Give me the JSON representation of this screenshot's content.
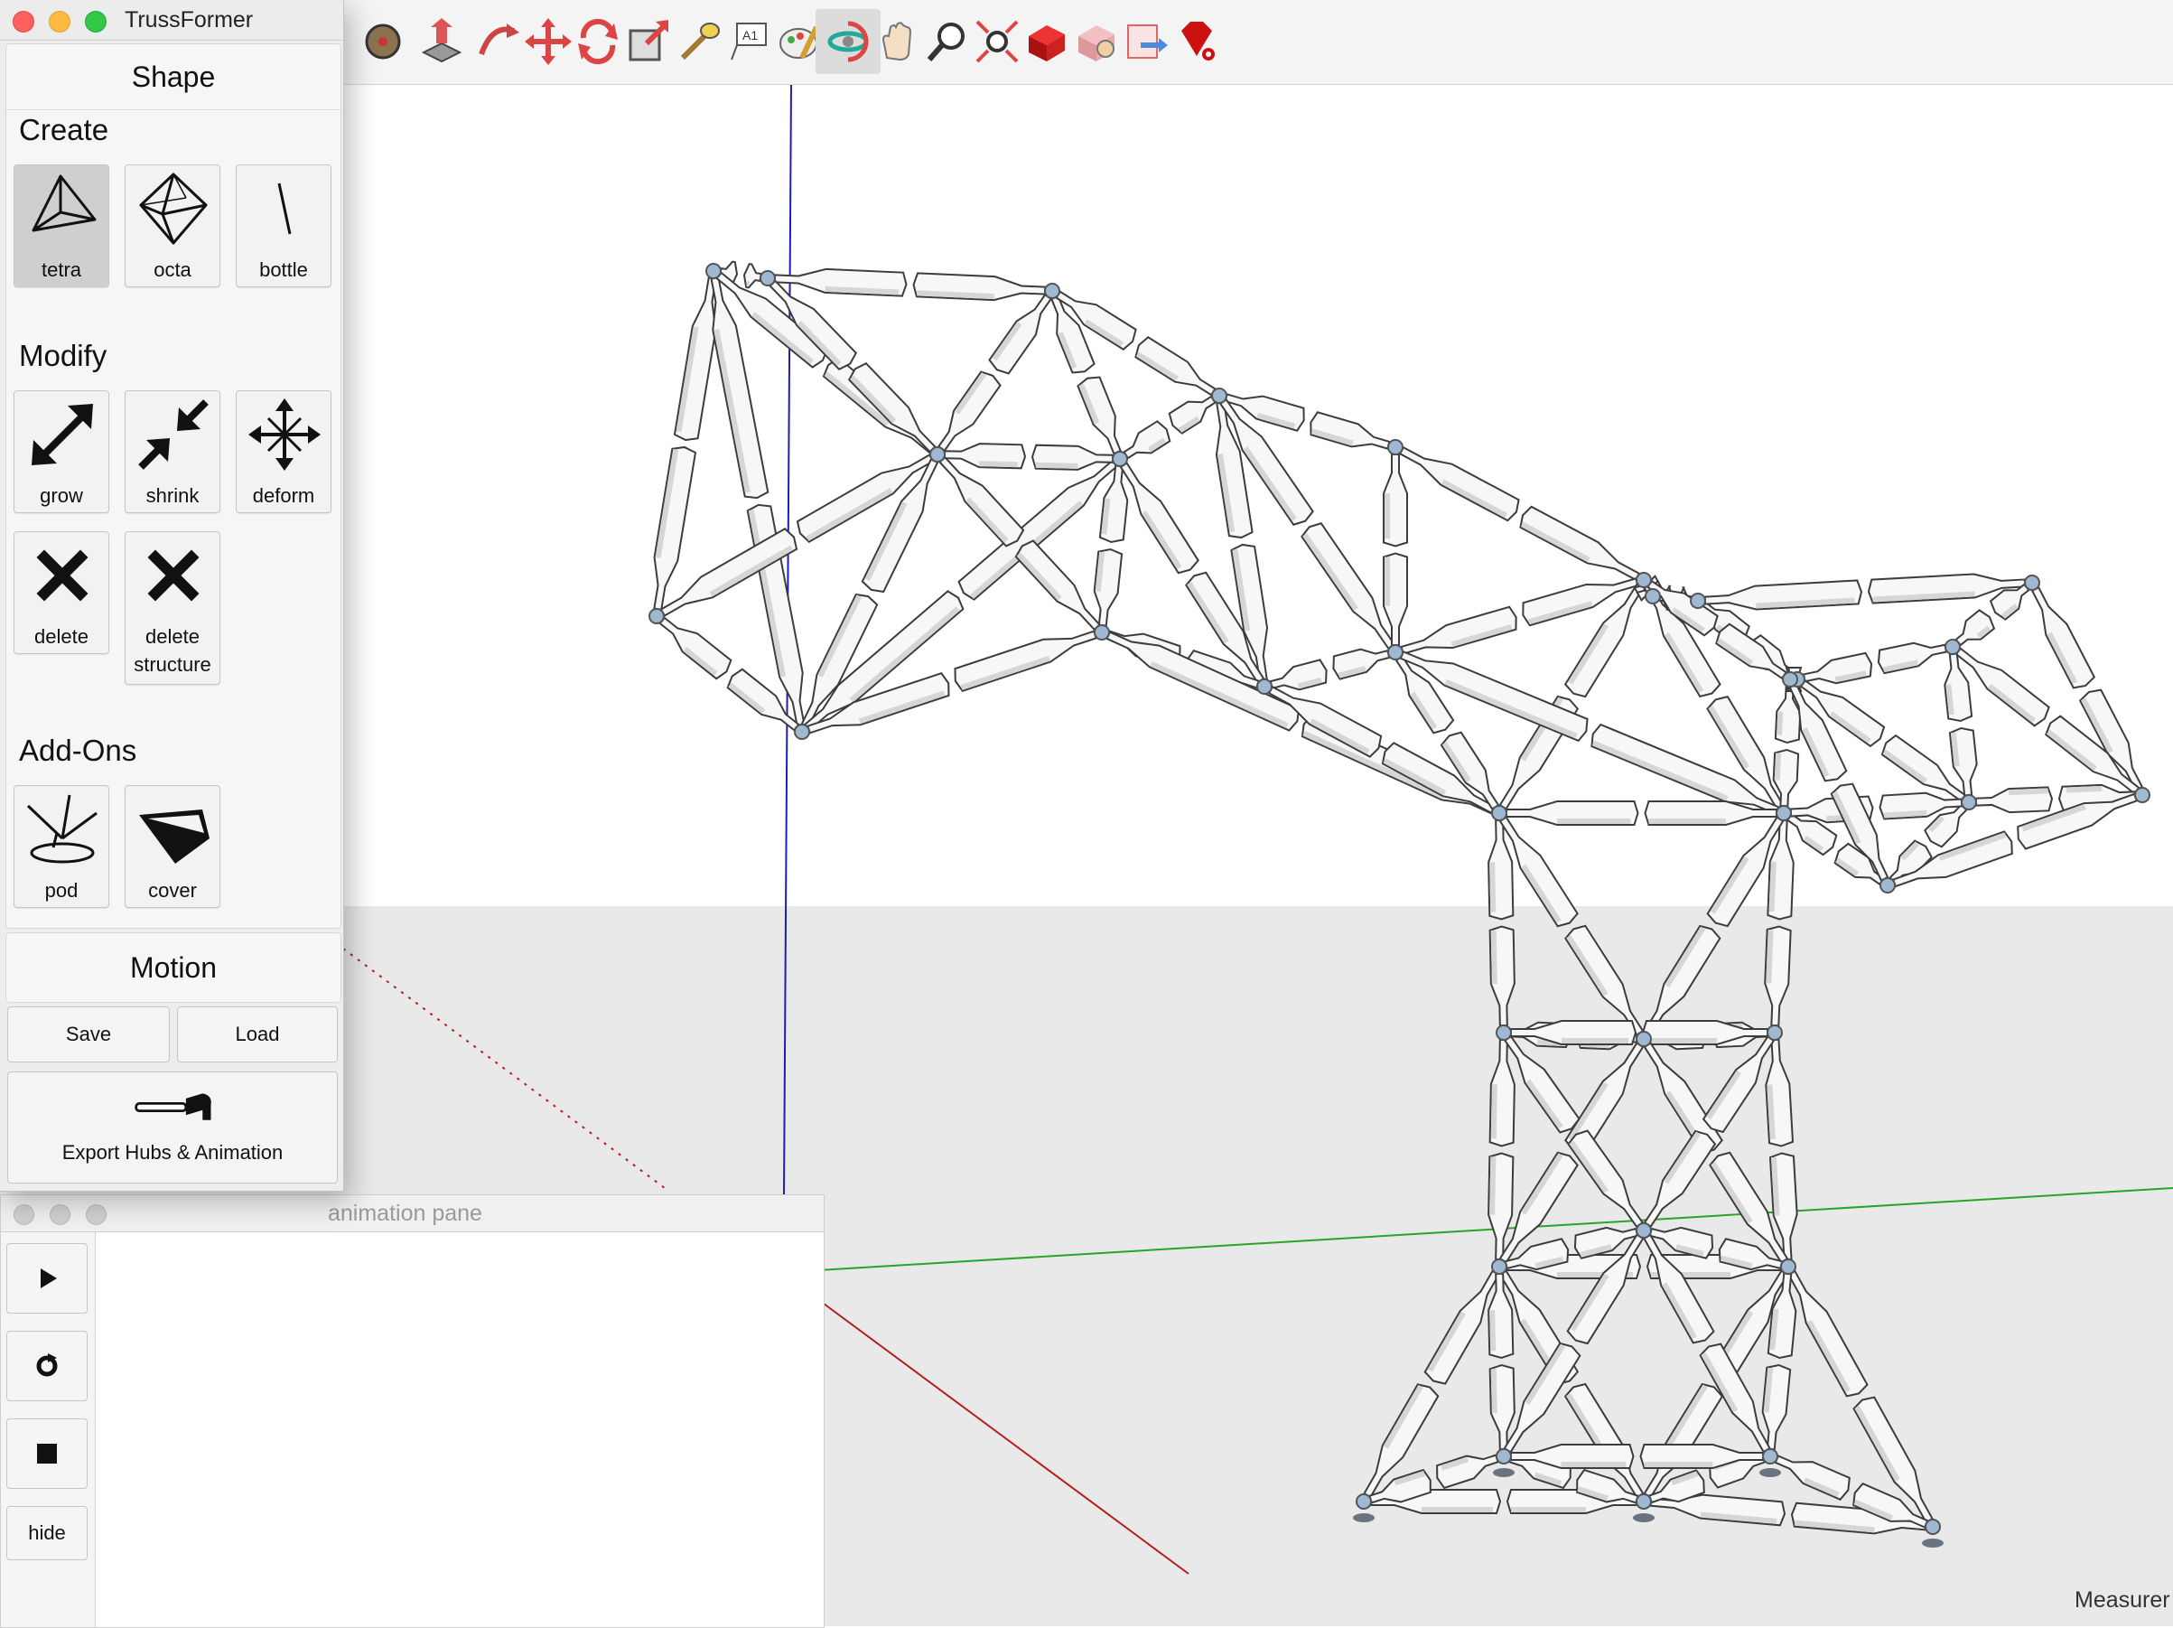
{
  "app": {
    "window_title": "TrussFormer"
  },
  "shape_panel": {
    "header": "Shape",
    "create": {
      "title": "Create",
      "tools": [
        {
          "label": "tetra",
          "icon": "tetrahedron-icon",
          "pressed": true
        },
        {
          "label": "octa",
          "icon": "octahedron-icon"
        },
        {
          "label": "bottle",
          "icon": "bottle-icon"
        }
      ]
    },
    "modify": {
      "title": "Modify",
      "tools": [
        {
          "label": "grow",
          "icon": "grow-arrows-icon"
        },
        {
          "label": "shrink",
          "icon": "shrink-arrows-icon"
        },
        {
          "label": "deform",
          "icon": "deform-arrows-icon"
        },
        {
          "label": "delete",
          "icon": "delete-x-icon"
        },
        {
          "label": "delete structure",
          "icon": "delete-structure-x-icon"
        }
      ]
    },
    "addons": {
      "title": "Add-Ons",
      "tools": [
        {
          "label": "pod",
          "icon": "pod-icon"
        },
        {
          "label": "cover",
          "icon": "cover-icon"
        }
      ]
    }
  },
  "motion_panel": {
    "header": "Motion"
  },
  "buttons": {
    "save": "Save",
    "load": "Load",
    "export": "Export Hubs & Animation",
    "export_icon": "hammer-icon"
  },
  "animation_pane": {
    "title": "animation pane",
    "controls": [
      {
        "name": "play-button",
        "icon": "play-icon"
      },
      {
        "name": "loop-button",
        "icon": "loop-icon"
      },
      {
        "name": "stop-button",
        "icon": "stop-icon"
      },
      {
        "name": "hide-button",
        "label": "hide"
      }
    ]
  },
  "toolbar": {
    "tools": [
      "tape-measure-icon",
      "push-pull-icon",
      "follow-me-icon",
      "move-icon",
      "rotate-icon",
      "scale-icon",
      "paint-bucket-icon",
      "text-icon",
      "paint-icon",
      "orbit-icon",
      "pan-icon",
      "zoom-icon",
      "zoom-extents-icon",
      "component-icon",
      "material-icon",
      "export-icon",
      "ruby-console-icon"
    ],
    "active_tool": "orbit-icon"
  },
  "status_bar": {
    "text": "Measurer"
  },
  "colors": {
    "axis_blue": "#1d1db8",
    "axis_green": "#2aa52a",
    "axis_red": "#b21d1d",
    "ground": "#e9e9e9",
    "hub": "#9fb9d3",
    "bottle_fill": "#f7f7f7"
  }
}
